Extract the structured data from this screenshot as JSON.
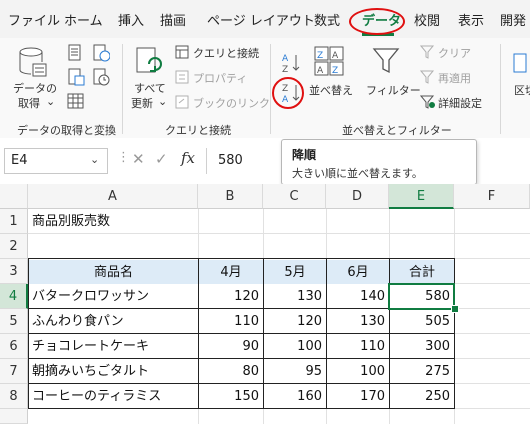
{
  "menu": {
    "tabs": [
      "ファイル",
      "ホーム",
      "挿入",
      "描画",
      "ページ レイアウト",
      "数式",
      "データ",
      "校閲",
      "表示",
      "開発"
    ]
  },
  "ribbon": {
    "get_data_label1": "データの",
    "get_data_label2": "取得",
    "refresh_label1": "すべて",
    "refresh_label2": "更新",
    "query_conn": "クエリと接続",
    "properties": "プロパティ",
    "book_link": "ブックのリンク",
    "sort": "並べ替え",
    "filter": "フィルター",
    "clear": "クリア",
    "reapply": "再適用",
    "advanced": "詳細設定",
    "partial_right": "区切",
    "group_get": "データの取得と変換",
    "group_query": "クエリと接続",
    "group_sort": "並べ替えとフィルター"
  },
  "formula": {
    "name_box": "E4",
    "value": "580",
    "fx": "fx"
  },
  "tooltip": {
    "title": "降順",
    "desc": "大きい順に並べ替えます。"
  },
  "columns": [
    "A",
    "B",
    "C",
    "D",
    "E",
    "F"
  ],
  "rows": [
    "1",
    "2",
    "3",
    "4",
    "5",
    "6",
    "7",
    "8"
  ],
  "sheet": {
    "title": "商品別販売数",
    "headers": [
      "商品名",
      "4月",
      "5月",
      "6月",
      "合計"
    ],
    "data": [
      [
        "バタークロワッサン",
        "120",
        "130",
        "140",
        "580"
      ],
      [
        "ふんわり食パン",
        "110",
        "120",
        "130",
        "505"
      ],
      [
        "チョコレートケーキ",
        "90",
        "100",
        "110",
        "300"
      ],
      [
        "朝摘みいちごタルト",
        "80",
        "95",
        "100",
        "275"
      ],
      [
        "コーヒーのティラミス",
        "150",
        "160",
        "170",
        "250"
      ]
    ]
  },
  "colors": {
    "accent": "#107c41",
    "highlight": "#ddebf7",
    "annotation": "#e01010"
  }
}
